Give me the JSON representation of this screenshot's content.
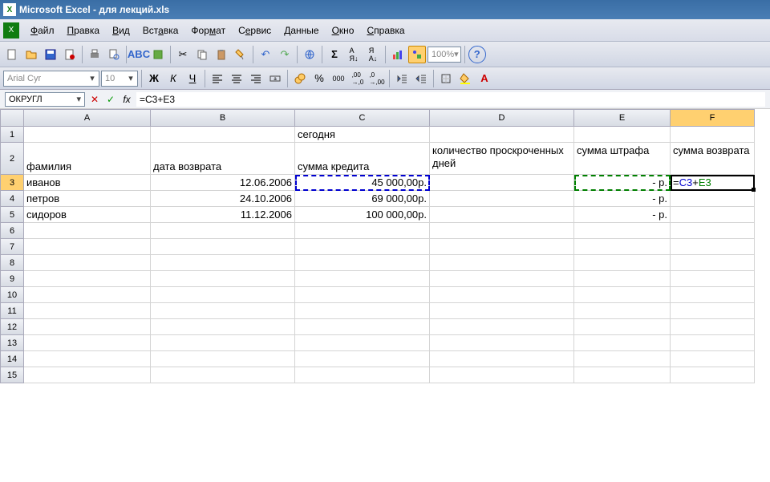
{
  "title": "Microsoft Excel - для лекций.xls",
  "menu": {
    "file": "Файл",
    "edit": "Правка",
    "view": "Вид",
    "insert": "Вставка",
    "format": "Формат",
    "tools": "Сервис",
    "data": "Данные",
    "window": "Окно",
    "help": "Справка"
  },
  "font": {
    "name": "Arial Cyr",
    "size": "10"
  },
  "zoom": "100%",
  "namebox": "ОКРУГЛ",
  "formula": "=C3+E3",
  "columns": [
    "A",
    "B",
    "C",
    "D",
    "E",
    "F"
  ],
  "rows": [
    "1",
    "2",
    "3",
    "4",
    "5",
    "6",
    "7",
    "8",
    "9",
    "10",
    "11",
    "12",
    "13",
    "14",
    "15"
  ],
  "active_row": "3",
  "active_col": "F",
  "cells": {
    "r1": {
      "c": "сегодня"
    },
    "r2": {
      "a": "фамилия",
      "b": "дата возврата",
      "c": "сумма кредита",
      "d": "количество проскроченных дней",
      "e": "сумма штрафа",
      "f": "сумма возврата"
    },
    "r3": {
      "a": "иванов",
      "b": "12.06.2006",
      "c": "45 000,00р.",
      "e": "-   р.",
      "f_c3": "C3",
      "f_plus": "+",
      "f_e3": "E3",
      "f_eq": "="
    },
    "r4": {
      "a": "петров",
      "b": "24.10.2006",
      "c": "69 000,00р.",
      "e": "-   р."
    },
    "r5": {
      "a": "сидоров",
      "b": "11.12.2006",
      "c": "100 000,00р.",
      "e": "-   р."
    }
  },
  "icons": {
    "new": "□",
    "open": "📂",
    "save": "💾",
    "perm": "🔒",
    "print": "🖨",
    "preview": "🔍",
    "spell": "✓",
    "research": "📖",
    "cut": "✂",
    "copy": "📋",
    "paste": "📄",
    "fmtpaint": "🖌",
    "undo": "↶",
    "redo": "↷",
    "link": "🔗",
    "sum": "Σ",
    "sortasc": "A↓",
    "sortdesc": "Я↓",
    "chart": "📊",
    "draw": "📐",
    "help": "?",
    "bold": "Ж",
    "italic": "К",
    "underline": "Ч",
    "alignl": "≡",
    "alignc": "≡",
    "alignr": "≡",
    "merge": "⊞",
    "currency": "₽",
    "percent": "%",
    "comma": ",0",
    "decinc": ",00",
    "decdec": ",0",
    "indent-": "◁",
    "indent+": "▷",
    "border": "▦",
    "fill": "🪣",
    "font-color": "A"
  }
}
